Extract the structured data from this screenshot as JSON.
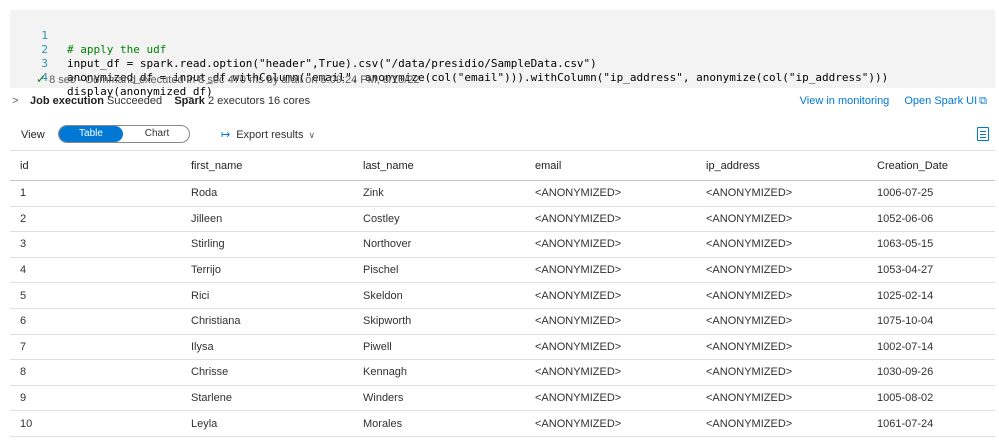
{
  "code": {
    "lines": [
      {
        "num": "1",
        "text": "# apply the udf"
      },
      {
        "num": "2",
        "text": "input_df = spark.read.option(\"header\",True).csv(\"/data/presidio/SampleData.csv\")"
      },
      {
        "num": "3",
        "text": "anonymized_df = input_df.withColumn(\"email\", anonymize(col(\"email\"))).withColumn(\"ip_address\", anonymize(col(\"ip_address\")))"
      },
      {
        "num": "4",
        "text": "display(anonymized_df)"
      }
    ],
    "status_duration": "8 sec",
    "status_text": "- Command executed in 8 sec 470 ms by arali on 5:09:24 PM, 8/15/22"
  },
  "job": {
    "label": "Job execution",
    "state": "Succeeded",
    "spark_label": "Spark",
    "spark_info": "2 executors 16 cores",
    "view_monitoring": "View in monitoring",
    "open_spark_ui": "Open Spark UI"
  },
  "toolbar": {
    "view_label": "View",
    "table_label": "Table",
    "chart_label": "Chart",
    "export_label": "Export results"
  },
  "icons": {
    "chevron": "chevron-right-icon",
    "check": "check-icon",
    "export": "export-arrow-icon",
    "external": "external-link-icon",
    "caret": "chevron-down-icon",
    "side": "side-panel-icon"
  },
  "colors": {
    "accent": "#0078d4",
    "success": "#107c10",
    "code_bg": "#f3f3f3"
  },
  "table": {
    "columns": [
      "id",
      "first_name",
      "last_name",
      "email",
      "ip_address",
      "Creation_Date"
    ],
    "rows": [
      [
        "1",
        "Roda",
        "Zink",
        "<ANONYMIZED>",
        "<ANONYMIZED>",
        "1006-07-25"
      ],
      [
        "2",
        "Jilleen",
        "Costley",
        "<ANONYMIZED>",
        "<ANONYMIZED>",
        "1052-06-06"
      ],
      [
        "3",
        "Stirling",
        "Northover",
        "<ANONYMIZED>",
        "<ANONYMIZED>",
        "1063-05-15"
      ],
      [
        "4",
        "Terrijo",
        "Pischel",
        "<ANONYMIZED>",
        "<ANONYMIZED>",
        "1053-04-27"
      ],
      [
        "5",
        "Rici",
        "Skeldon",
        "<ANONYMIZED>",
        "<ANONYMIZED>",
        "1025-02-14"
      ],
      [
        "6",
        "Christiana",
        "Skipworth",
        "<ANONYMIZED>",
        "<ANONYMIZED>",
        "1075-10-04"
      ],
      [
        "7",
        "Ilysa",
        "Piwell",
        "<ANONYMIZED>",
        "<ANONYMIZED>",
        "1002-07-14"
      ],
      [
        "8",
        "Chrisse",
        "Kennagh",
        "<ANONYMIZED>",
        "<ANONYMIZED>",
        "1030-09-26"
      ],
      [
        "9",
        "Starlene",
        "Winders",
        "<ANONYMIZED>",
        "<ANONYMIZED>",
        "1005-08-02"
      ],
      [
        "10",
        "Leyla",
        "Morales",
        "<ANONYMIZED>",
        "<ANONYMIZED>",
        "1061-07-24"
      ]
    ]
  }
}
